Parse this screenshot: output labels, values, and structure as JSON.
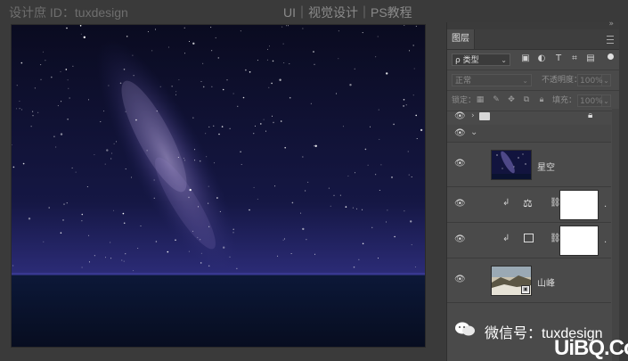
{
  "watermark": {
    "left": "设计庶 ID：tuxdesign",
    "center": "UI｜视觉设计｜PS教程",
    "bottom_wechat": "微信号：tuxdesign",
    "bottom_logo": "UiBQ.CoM"
  },
  "panel": {
    "tab_label": "图层",
    "filter_value": "ρ 类型",
    "blend_mode": "正常",
    "opacity_label": "不透明度：",
    "opacity_value": "100%",
    "lock_label": "锁定：",
    "fill_label": "填充：",
    "fill_value": "100%"
  },
  "layers": [
    {
      "name": "",
      "kind": "group-collapsed",
      "locked": true
    },
    {
      "name": "",
      "kind": "group-expanded"
    },
    {
      "name": "星空",
      "kind": "image",
      "thumb": "stars"
    },
    {
      "name": "",
      "kind": "adjustment",
      "icon": "balance-icon",
      "clipped": true,
      "suffix": "."
    },
    {
      "name": "",
      "kind": "adjustment",
      "icon": "levels-icon",
      "clipped": true,
      "suffix": "."
    },
    {
      "name": "山峰",
      "kind": "image",
      "thumb": "mountain"
    }
  ],
  "colors": {
    "panel_bg": "#4a4a4a",
    "canvas_bg": "#0b0c22",
    "sky_accent": "#6a5fb8"
  }
}
